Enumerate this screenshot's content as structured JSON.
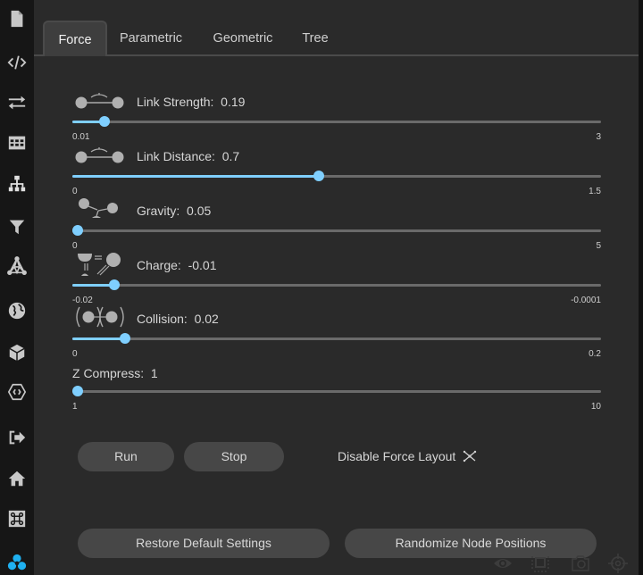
{
  "sidebar": {
    "items": [
      {
        "name": "file-icon"
      },
      {
        "name": "code-icon"
      },
      {
        "name": "swap-arrows-icon"
      },
      {
        "name": "table-icon"
      },
      {
        "name": "hierarchy-icon"
      },
      {
        "name": "filter-icon"
      },
      {
        "name": "network-icon"
      },
      {
        "name": "globe-icon"
      },
      {
        "name": "cube-icon"
      },
      {
        "name": "hexagon-code-icon"
      },
      {
        "name": "sign-out-icon"
      },
      {
        "name": "home-icon"
      },
      {
        "name": "command-icon"
      },
      {
        "name": "app-logo-icon"
      }
    ],
    "accent": "#1fb0f0"
  },
  "tabs": [
    {
      "label": "Force",
      "active": true
    },
    {
      "label": "Parametric",
      "active": false
    },
    {
      "label": "Geometric",
      "active": false
    },
    {
      "label": "Tree",
      "active": false
    }
  ],
  "sliders": [
    {
      "label": "Link Strength:",
      "value": "0.19",
      "min": "0.01",
      "max": "3",
      "fraction": 0.06,
      "icon": "link-strength-icon"
    },
    {
      "label": "Link Distance:",
      "value": "0.7",
      "min": "0",
      "max": "1.5",
      "fraction": 0.467,
      "icon": "link-distance-icon"
    },
    {
      "label": "Gravity:",
      "value": "0.05",
      "min": "0",
      "max": "5",
      "fraction": 0.01,
      "icon": "gravity-icon"
    },
    {
      "label": "Charge:",
      "value": "-0.01",
      "min": "-0.02",
      "max": "-0.0001",
      "fraction": 0.08,
      "icon": "charge-icon"
    },
    {
      "label": "Collision:",
      "value": "0.02",
      "min": "0",
      "max": "0.2",
      "fraction": 0.1,
      "icon": "collision-icon"
    },
    {
      "label": "Z Compress:",
      "value": "1",
      "min": "1",
      "max": "10",
      "fraction": 0.0,
      "icon": null
    }
  ],
  "buttons": {
    "run": "Run",
    "stop": "Stop",
    "disable_force_layout": "Disable Force Layout",
    "restore_defaults": "Restore Default Settings",
    "randomize_nodes": "Randomize Node Positions"
  },
  "colors": {
    "slider_accent": "#7fcfff",
    "background": "#2a2a2a",
    "sidebar": "#161616"
  },
  "bottom_toolbar": [
    {
      "name": "eye-icon"
    },
    {
      "name": "selection-box-icon"
    },
    {
      "name": "camera-icon"
    },
    {
      "name": "crosshair-icon"
    }
  ]
}
